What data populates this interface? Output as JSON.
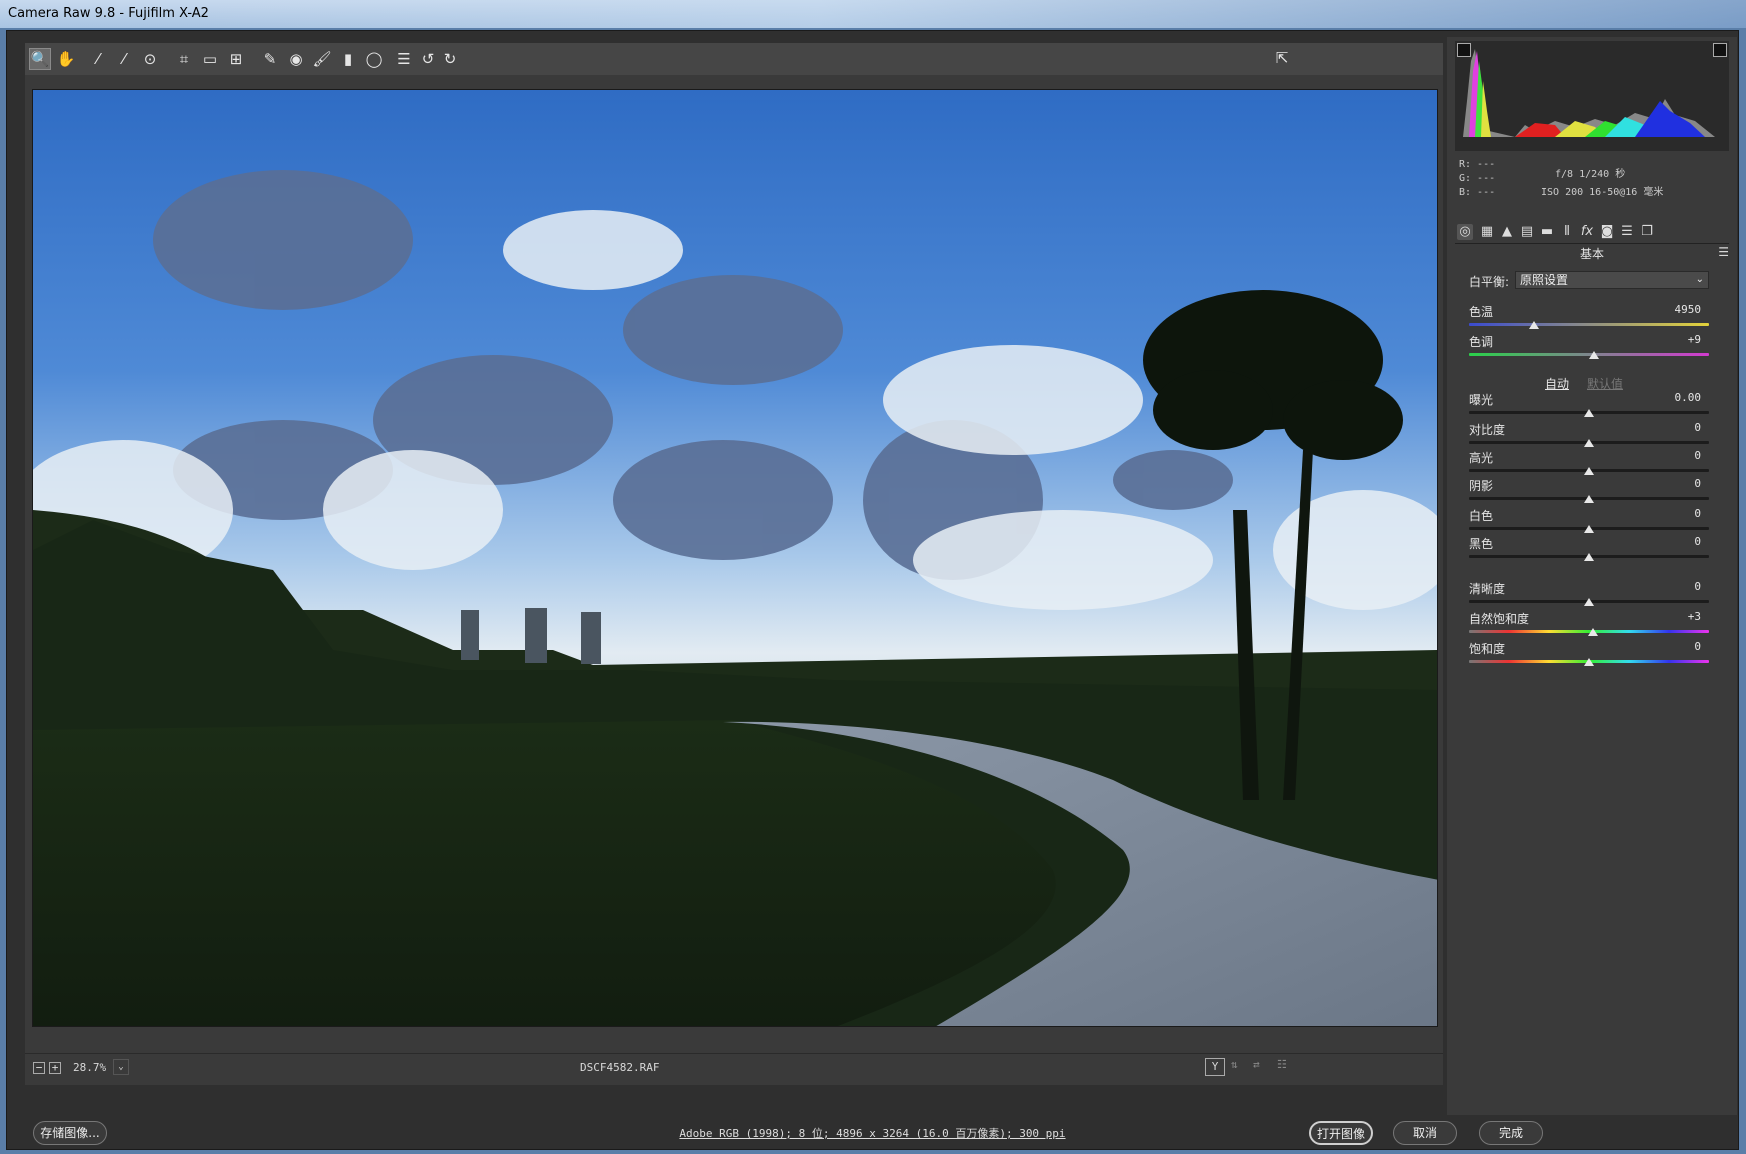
{
  "titlebar": {
    "title": "Camera Raw 9.8 -  Fujifilm X-A2"
  },
  "toolbar": {
    "tools": [
      {
        "name": "zoom-tool-icon",
        "glyph": "🔍"
      },
      {
        "name": "hand-tool-icon",
        "glyph": "✋"
      },
      {
        "name": "white-balance-tool-icon",
        "glyph": "⁄"
      },
      {
        "name": "color-sampler-tool-icon",
        "glyph": "⁄"
      },
      {
        "name": "targeted-adjustment-tool-icon",
        "glyph": "⊙"
      },
      {
        "name": "crop-tool-icon",
        "glyph": "⌗"
      },
      {
        "name": "straighten-tool-icon",
        "glyph": "▭"
      },
      {
        "name": "transform-tool-icon",
        "glyph": "⊞"
      },
      {
        "name": "spot-removal-tool-icon",
        "glyph": "✎"
      },
      {
        "name": "red-eye-tool-icon",
        "glyph": "◉"
      },
      {
        "name": "adjustment-brush-icon",
        "glyph": "🖌"
      },
      {
        "name": "graduated-filter-icon",
        "glyph": "▮"
      },
      {
        "name": "radial-filter-icon",
        "glyph": "◯"
      },
      {
        "name": "preferences-icon",
        "glyph": "☰"
      },
      {
        "name": "rotate-left-icon",
        "glyph": "↺"
      },
      {
        "name": "rotate-right-icon",
        "glyph": "↻"
      }
    ],
    "fullscreen_glyph": "⇱"
  },
  "status": {
    "zoom": "28.7%",
    "filename": "DSCF4582.RAF"
  },
  "readout": {
    "r": "R:  ---",
    "g": "G:  ---",
    "b": "B:  ---",
    "exposure": "f/8   1/240 秒",
    "iso_lens": "ISO 200   16-50@16 毫米"
  },
  "panel": {
    "section_title": "基本",
    "wb_label": "白平衡:",
    "wb_value": "原照设置",
    "auto_label": "自动",
    "default_label": "默认值",
    "sliders": {
      "temp": {
        "label": "色温",
        "value": "4950",
        "level": 0.27
      },
      "tint": {
        "label": "色调",
        "value": "+9",
        "level": 0.52
      },
      "exposure": {
        "label": "曝光",
        "value": "0.00",
        "level": 0.5
      },
      "contrast": {
        "label": "对比度",
        "value": "0",
        "level": 0.5
      },
      "highlights": {
        "label": "高光",
        "value": "0",
        "level": 0.5
      },
      "shadows": {
        "label": "阴影",
        "value": "0",
        "level": 0.5
      },
      "whites": {
        "label": "白色",
        "value": "0",
        "level": 0.5
      },
      "blacks": {
        "label": "黑色",
        "value": "0",
        "level": 0.5
      },
      "clarity": {
        "label": "清晰度",
        "value": "0",
        "level": 0.5
      },
      "vibrance": {
        "label": "自然饱和度",
        "value": "+3",
        "level": 0.515
      },
      "saturation": {
        "label": "饱和度",
        "value": "0",
        "level": 0.5
      }
    }
  },
  "bottom": {
    "save_label": "存储图像...",
    "info": "Adobe RGB (1998); 8 位; 4896 x 3264 (16.0 百万像素); 300 ppi",
    "open_label": "打开图像",
    "cancel_label": "取消",
    "done_label": "完成"
  },
  "colors": {
    "panel_bg": "#3a3a3a",
    "track_temp": "linear-gradient(90deg,#3a4bd0,#e3d23a)",
    "track_tint": "linear-gradient(90deg,#2ad14a,#d23ad0)",
    "track_neutral": "#1c1c1c",
    "track_vib": "linear-gradient(90deg,#777,#e33,#fd3,#3e3,#3de,#33e,#e3e)"
  }
}
